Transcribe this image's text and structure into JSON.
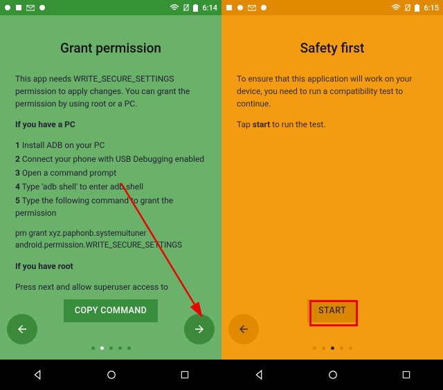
{
  "left": {
    "statusbar": {
      "time": "6:14",
      "icons": [
        "app",
        "gallery",
        "mail",
        "app2"
      ]
    },
    "title": "Grant permission",
    "intro": "This app needs WRITE_SECURE_SETTINGS permission to apply changes. You can grant the permission by using root or a PC.",
    "pc_heading": "If you have a PC",
    "steps": [
      {
        "n": "1",
        "t": "Install ADB on your PC"
      },
      {
        "n": "2",
        "t": "Connect your phone with USB Debugging enabled"
      },
      {
        "n": "3",
        "t": "Open a command prompt"
      },
      {
        "n": "4",
        "t": "Type 'adb shell' to enter adb shell"
      },
      {
        "n": "5",
        "t": "Type the following command to grant the permission"
      }
    ],
    "command": "pm grant xyz.paphonb.systemuituner android.permission.WRITE_SECURE_SETTINGS",
    "root_heading": "If you have root",
    "root_text": "Press next and allow superuser access to",
    "button": "COPY COMMAND",
    "dots": {
      "count": 5,
      "active": 1
    }
  },
  "right": {
    "statusbar": {
      "time": "6:15",
      "icons": [
        "app",
        "gallery",
        "mail",
        "app2"
      ]
    },
    "title": "Safety first",
    "para1": "To ensure that this application will work on your device, you need to run a compatibility test to continue.",
    "para2_pre": "Tap ",
    "para2_bold": "start",
    "para2_post": " to run the test.",
    "button": "START",
    "dots": {
      "count": 5,
      "active": 2
    }
  },
  "nav_icons": [
    "back-triangle",
    "home-circle",
    "recent-square"
  ]
}
